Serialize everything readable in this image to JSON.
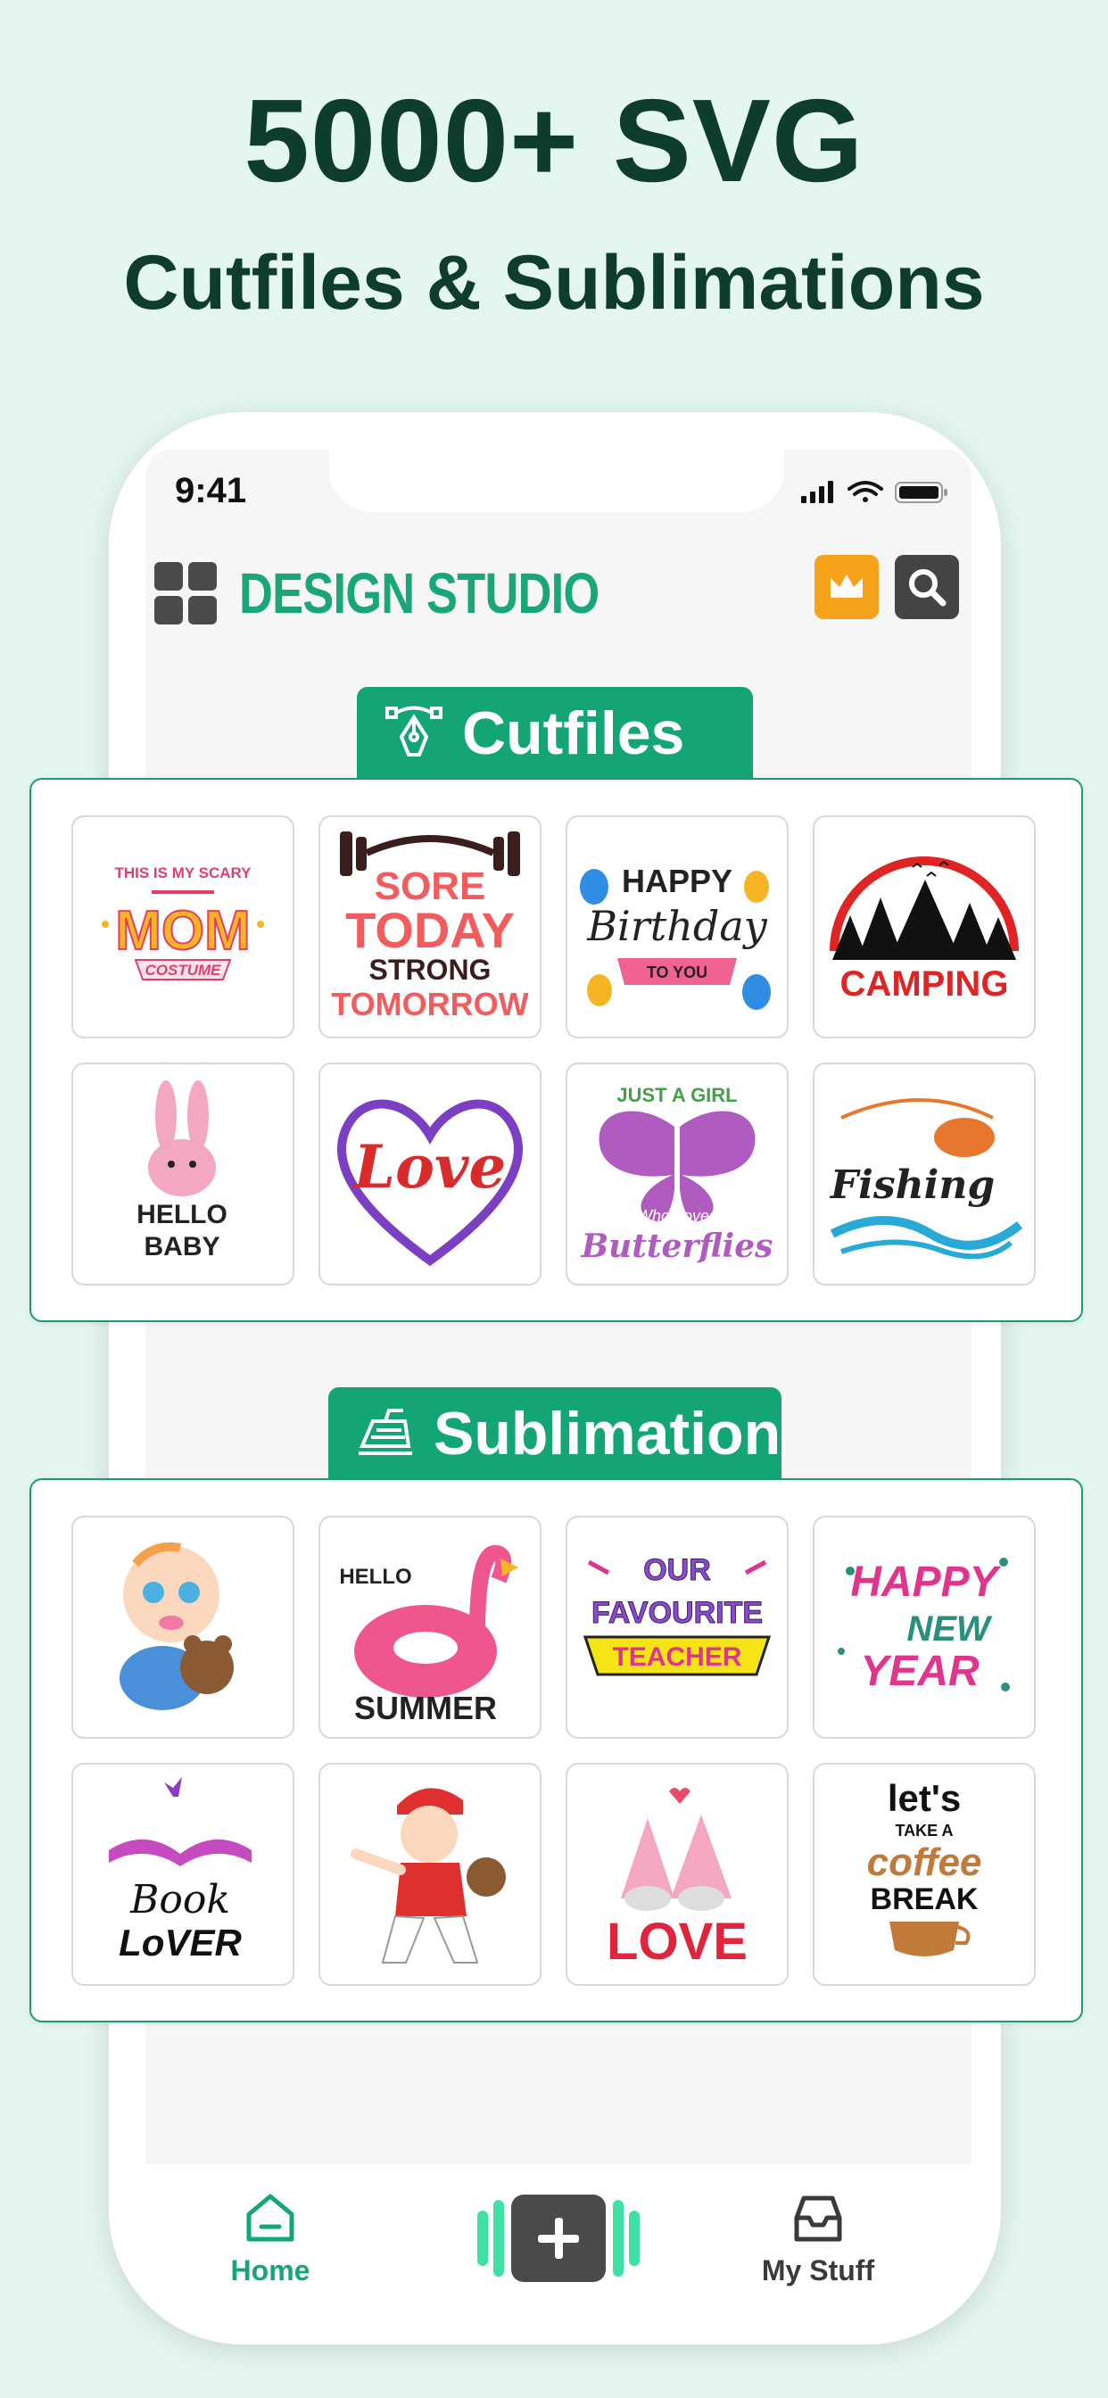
{
  "promo": {
    "headline": "5000+ SVG",
    "subheadline": "Cutfiles & Sublimations"
  },
  "status_bar": {
    "time": "9:41"
  },
  "app": {
    "brand": "DESIGN STUDIO",
    "menu_icon": "grid-menu-icon",
    "premium_icon": "crown-icon",
    "search_icon": "search-icon",
    "accent_color": "#14a672",
    "premium_color": "#f7a21b"
  },
  "sections": {
    "cutfiles": {
      "title": "Cutfiles",
      "icon": "pen-tool-icon",
      "items": [
        {
          "line1": "THIS IS MY SCARY",
          "line2": "MOM",
          "line3": "COSTUME"
        },
        {
          "line1": "SORE",
          "line2": "TODAY",
          "line3": "STRONG",
          "line4": "TOMORROW"
        },
        {
          "line1": "HAPPY",
          "line2": "Birthday",
          "line3": "TO YOU"
        },
        {
          "line1": "CAMPING"
        },
        {
          "line1": "HELLO",
          "line2": "BABY"
        },
        {
          "line1": "Love"
        },
        {
          "line1": "JUST A GIRL",
          "line2": "Who Loves",
          "line3": "Butterflies"
        },
        {
          "line1": "Fishing"
        }
      ]
    },
    "sublimation": {
      "title": "Sublimation",
      "icon": "iron-icon",
      "items": [
        {
          "line1": ""
        },
        {
          "line1": "HELLO",
          "line2": "SUMMER"
        },
        {
          "line1": "OUR",
          "line2": "FAVOURITE",
          "line3": "TEACHER"
        },
        {
          "line1": "HAPPY",
          "line2": "NEW",
          "line3": "YEAR"
        },
        {
          "line1": "Book",
          "line2": "LoVER"
        },
        {
          "line1": ""
        },
        {
          "line1": "LOVE"
        },
        {
          "line1": "let's",
          "line2": "TAKE A",
          "line3": "coffee",
          "line4": "BREAK"
        }
      ]
    }
  },
  "bottom_nav": {
    "home_label": "Home",
    "mystuff_label": "My Stuff",
    "home_icon": "home-icon",
    "add_icon": "plus-icon",
    "mystuff_icon": "inbox-icon"
  }
}
